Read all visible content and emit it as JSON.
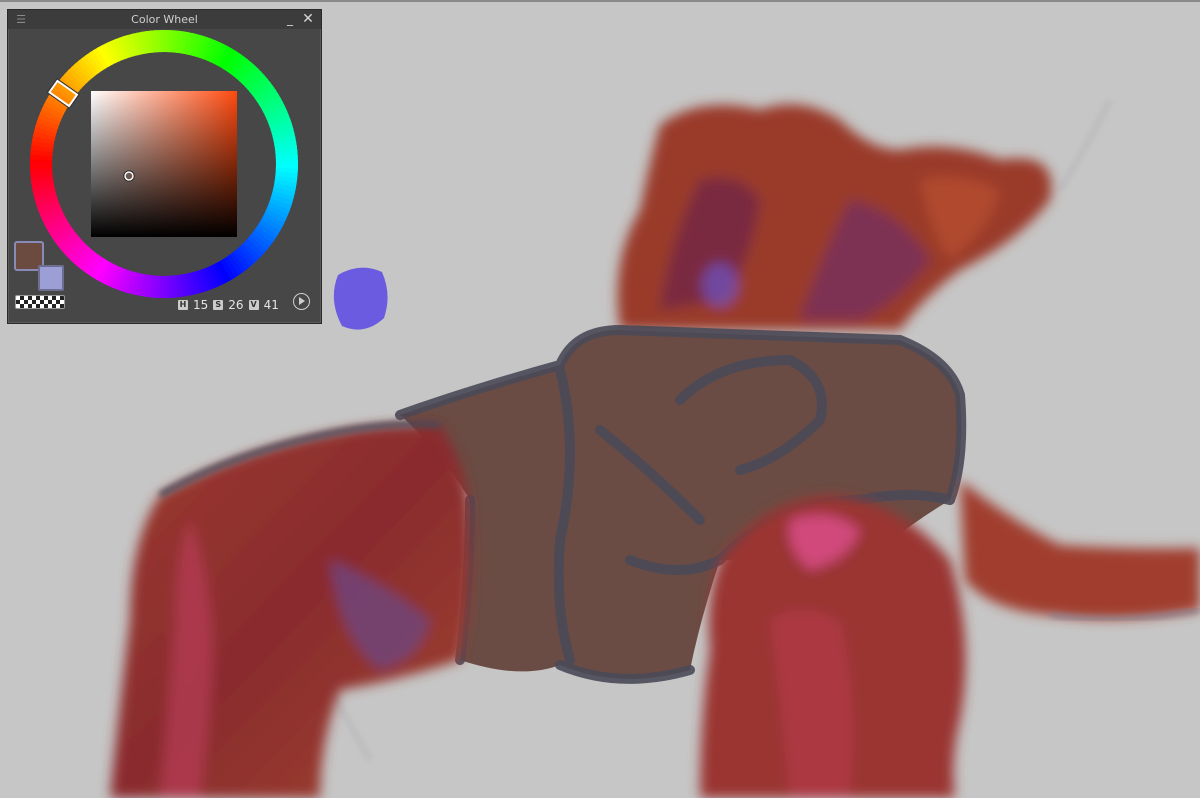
{
  "panel": {
    "title": "Color Wheel",
    "menu_icon": "hamburger-icon",
    "minimize_icon": "minimize-icon",
    "minimize_glyph": "_",
    "close_icon": "close-icon",
    "close_glyph": "✕"
  },
  "color": {
    "main_hex": "#6b4b3f",
    "sub_hex": "#9c9fd6",
    "h_label": "H",
    "h_value": "15",
    "s_label": "S",
    "s_value": "26",
    "v_label": "V",
    "v_value": "41"
  },
  "canvas": {
    "background": "#c6c6c6",
    "paint_colors": [
      "#8f2f28",
      "#a8452c",
      "#6b4b3f",
      "#4b4b5a",
      "#6a5be0",
      "#d04a7a"
    ]
  }
}
